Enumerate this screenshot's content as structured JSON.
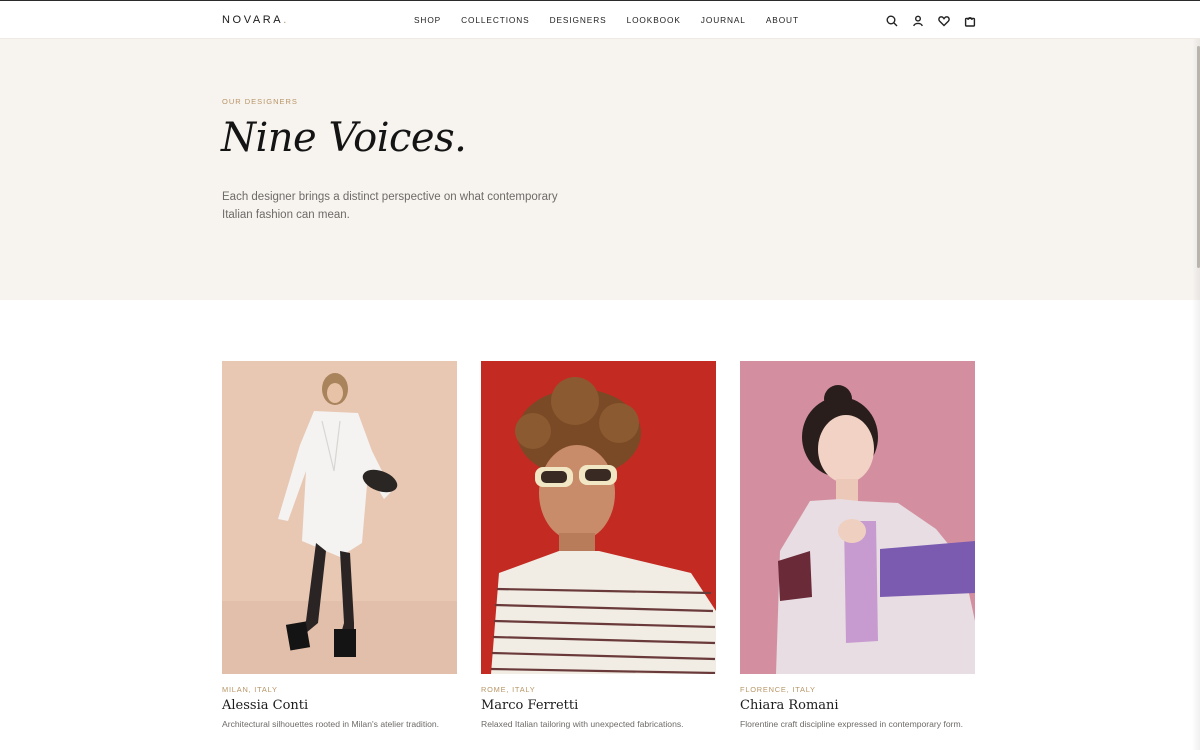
{
  "header": {
    "brand": "NOVARA",
    "brand_dot": ".",
    "nav": [
      "SHOP",
      "COLLECTIONS",
      "DESIGNERS",
      "LOOKBOOK",
      "JOURNAL",
      "ABOUT"
    ],
    "icons": [
      "search-icon",
      "user-icon",
      "heart-icon",
      "bag-icon"
    ]
  },
  "hero": {
    "eyebrow": "OUR DESIGNERS",
    "title": "Nine Voices.",
    "description": "Each designer brings a distinct perspective on what contemporary Italian fashion can mean."
  },
  "designers": [
    {
      "location": "MILAN, ITALY",
      "name": "Alessia Conti",
      "bio": "Architectural silhouettes rooted in Milan's atelier tradition.",
      "bg_color": "#e8c7b3"
    },
    {
      "location": "ROME, ITALY",
      "name": "Marco Ferretti",
      "bio": "Relaxed Italian tailoring with unexpected fabrications.",
      "bg_color": "#c32a22"
    },
    {
      "location": "FLORENCE, ITALY",
      "name": "Chiara Romani",
      "bio": "Florentine craft discipline expressed in contemporary form.",
      "bg_color": "#d38fa0"
    }
  ],
  "colors": {
    "accent": "#b89566",
    "hero_bg": "#f7f4f0",
    "text": "#1c1c1c"
  }
}
